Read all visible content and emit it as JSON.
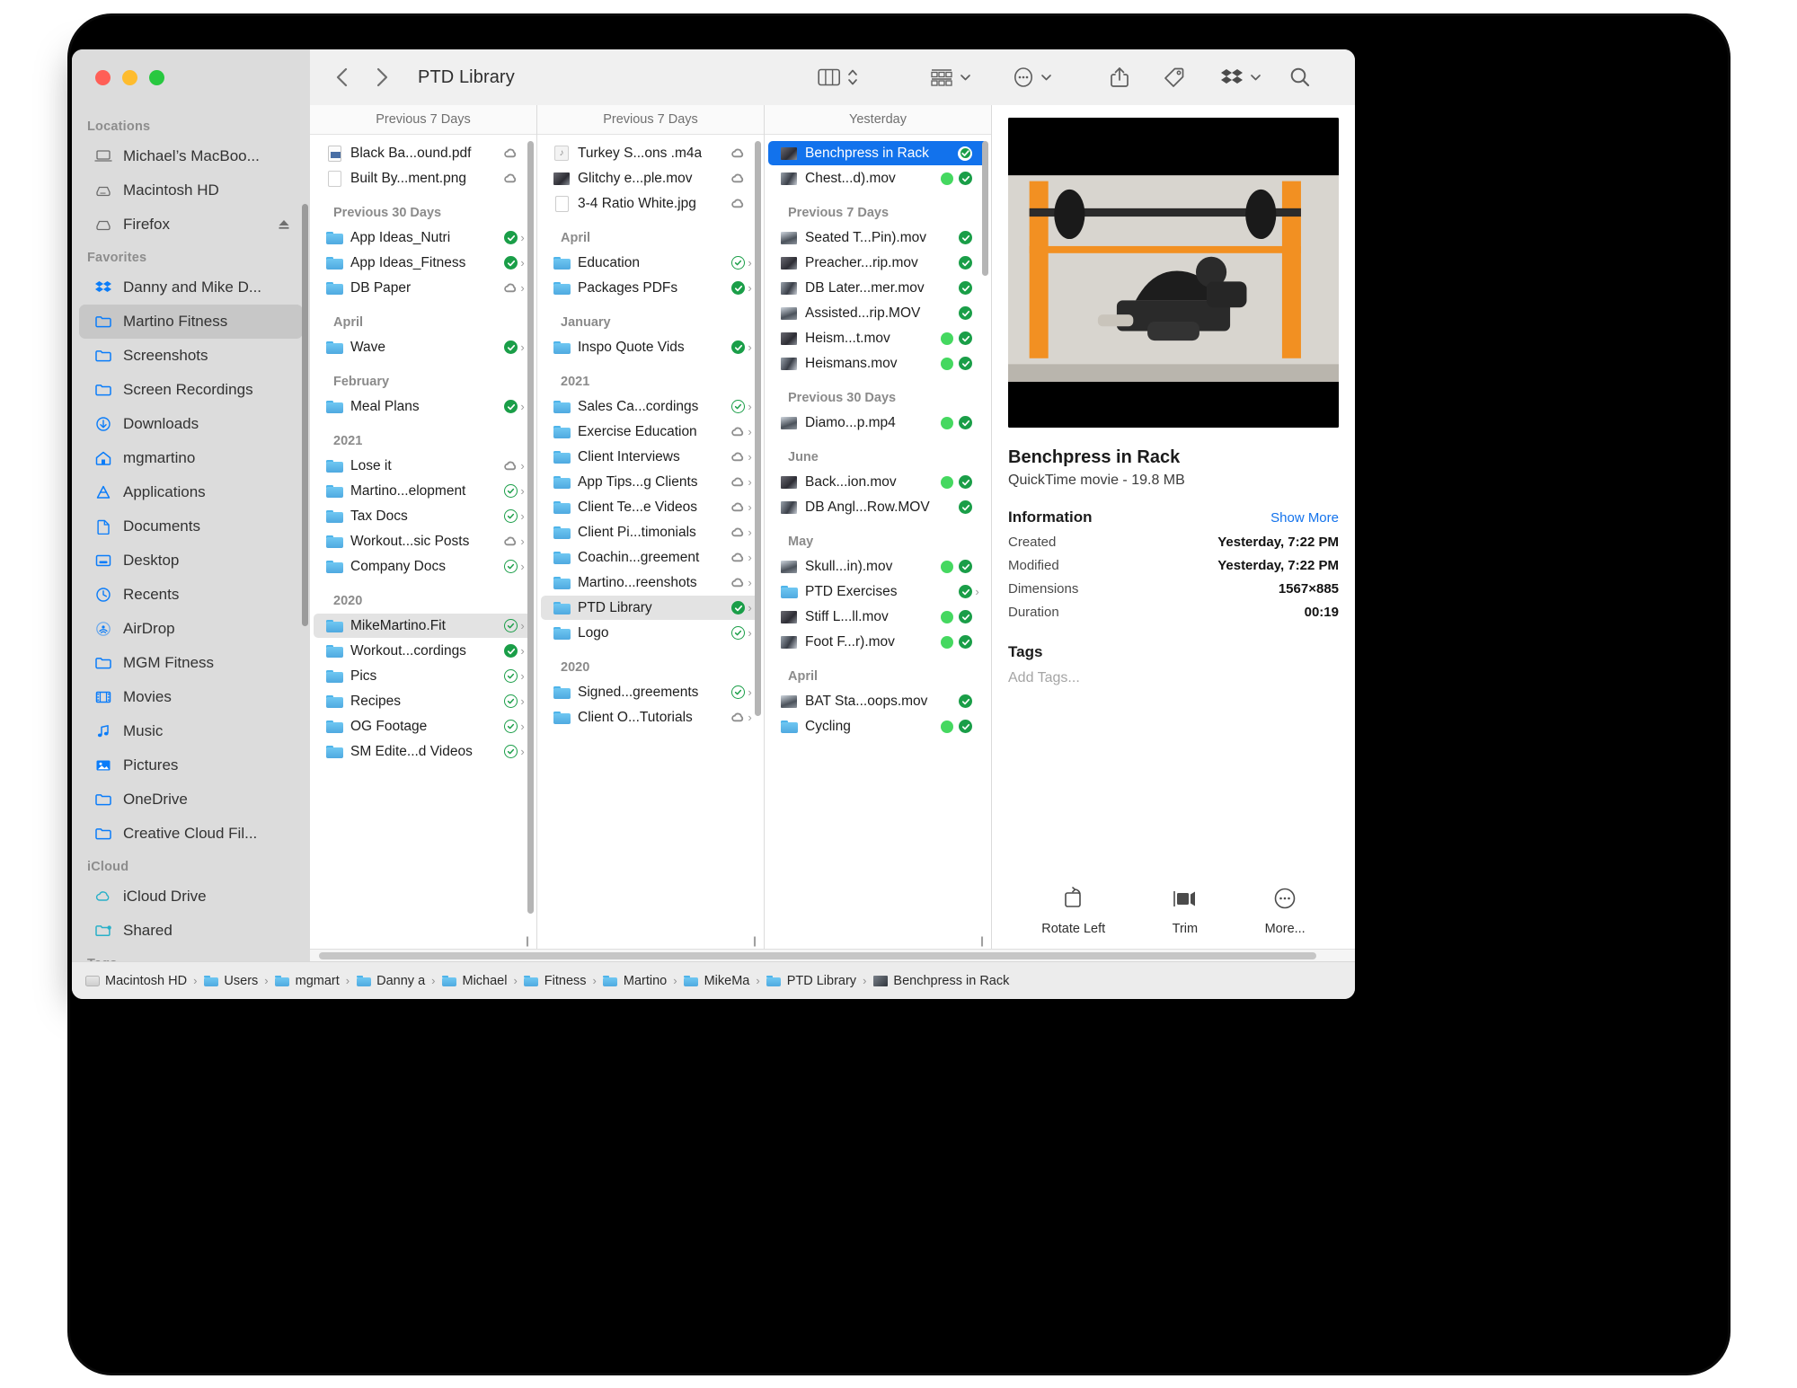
{
  "window": {
    "title": "PTD Library",
    "traffic": [
      "close",
      "minimize",
      "zoom"
    ]
  },
  "toolbar": {
    "back": "back-arrow",
    "forward": "forward-arrow",
    "view_mode": "column-view",
    "group_by": "group-by",
    "more": "more-options",
    "share": "share",
    "tag": "tag",
    "dropbox": "dropbox",
    "search": "search"
  },
  "sidebar": {
    "sections": [
      {
        "title": "Locations",
        "items": [
          {
            "label": "Michael’s MacBoo...",
            "icon": "laptop-icon",
            "tint": "gray",
            "eject": false
          },
          {
            "label": "Macintosh HD",
            "icon": "harddisk-icon",
            "tint": "gray",
            "eject": false
          },
          {
            "label": "Firefox",
            "icon": "disk-icon",
            "tint": "gray",
            "eject": true
          }
        ]
      },
      {
        "title": "Favorites",
        "items": [
          {
            "label": "Danny and Mike D...",
            "icon": "dropbox-icon",
            "tint": "blue",
            "eject": false
          },
          {
            "label": "Martino Fitness",
            "icon": "folder-icon",
            "tint": "blue",
            "eject": false,
            "active": true
          },
          {
            "label": "Screenshots",
            "icon": "folder-icon",
            "tint": "blue",
            "eject": false
          },
          {
            "label": "Screen Recordings",
            "icon": "folder-icon",
            "tint": "blue",
            "eject": false
          },
          {
            "label": "Downloads",
            "icon": "download-icon",
            "tint": "blue",
            "eject": false
          },
          {
            "label": "mgmartino",
            "icon": "home-icon",
            "tint": "blue",
            "eject": false
          },
          {
            "label": "Applications",
            "icon": "applications-icon",
            "tint": "blue",
            "eject": false
          },
          {
            "label": "Documents",
            "icon": "document-icon",
            "tint": "blue",
            "eject": false
          },
          {
            "label": "Desktop",
            "icon": "desktop-icon",
            "tint": "blue",
            "eject": false
          },
          {
            "label": "Recents",
            "icon": "clock-icon",
            "tint": "blue",
            "eject": false
          },
          {
            "label": "AirDrop",
            "icon": "airdrop-icon",
            "tint": "blue",
            "eject": false
          },
          {
            "label": "MGM Fitness",
            "icon": "folder-icon",
            "tint": "blue",
            "eject": false
          },
          {
            "label": "Movies",
            "icon": "film-icon",
            "tint": "blue",
            "eject": false
          },
          {
            "label": "Music",
            "icon": "music-icon",
            "tint": "blue",
            "eject": false
          },
          {
            "label": "Pictures",
            "icon": "pictures-icon",
            "tint": "blue",
            "eject": false
          },
          {
            "label": "OneDrive",
            "icon": "folder-icon",
            "tint": "blue",
            "eject": false
          },
          {
            "label": "Creative Cloud Fil...",
            "icon": "folder-icon",
            "tint": "blue",
            "eject": false
          }
        ]
      },
      {
        "title": "iCloud",
        "items": [
          {
            "label": "iCloud Drive",
            "icon": "cloud-icon",
            "tint": "teal",
            "eject": false
          },
          {
            "label": "Shared",
            "icon": "shared-folder-icon",
            "tint": "teal",
            "eject": false
          }
        ]
      },
      {
        "title": "Tags",
        "items": []
      }
    ]
  },
  "columns": [
    {
      "header": "Previous 7 Days",
      "groups": [
        {
          "label": "",
          "items": [
            {
              "name": "Black Ba...ound.pdf",
              "icon": "pdf-file-icon",
              "badges": [
                "cloud"
              ],
              "chevron": false
            },
            {
              "name": "Built By...ment.png",
              "icon": "image-file-icon",
              "badges": [
                "cloud"
              ],
              "chevron": false
            }
          ]
        },
        {
          "label": "Previous 30 Days",
          "items": [
            {
              "name": "App Ideas_Nutri",
              "icon": "folder-icon",
              "badges": [
                "check-filled"
              ],
              "chevron": true
            },
            {
              "name": "App Ideas_Fitness",
              "icon": "folder-icon",
              "badges": [
                "check-filled"
              ],
              "chevron": true
            },
            {
              "name": "DB Paper",
              "icon": "folder-icon",
              "badges": [
                "cloud"
              ],
              "chevron": true
            }
          ]
        },
        {
          "label": "April",
          "items": [
            {
              "name": "Wave",
              "icon": "folder-icon",
              "badges": [
                "check-filled"
              ],
              "chevron": true
            }
          ]
        },
        {
          "label": "February",
          "items": [
            {
              "name": "Meal Plans",
              "icon": "folder-icon",
              "badges": [
                "check-filled"
              ],
              "chevron": true
            }
          ]
        },
        {
          "label": "2021",
          "items": [
            {
              "name": "Lose it",
              "icon": "folder-icon",
              "badges": [
                "cloud"
              ],
              "chevron": true
            },
            {
              "name": "Martino...elopment",
              "icon": "folder-icon",
              "badges": [
                "check-outline"
              ],
              "chevron": true
            },
            {
              "name": "Tax Docs",
              "icon": "folder-icon",
              "badges": [
                "check-outline"
              ],
              "chevron": true
            },
            {
              "name": "Workout...sic Posts",
              "icon": "folder-icon",
              "badges": [
                "cloud"
              ],
              "chevron": true
            },
            {
              "name": "Company Docs",
              "icon": "folder-icon",
              "badges": [
                "check-outline"
              ],
              "chevron": true
            }
          ]
        },
        {
          "label": "2020",
          "items": [
            {
              "name": "MikeMartino.Fit",
              "icon": "folder-icon",
              "badges": [
                "check-outline"
              ],
              "chevron": true,
              "highlight": "gray"
            },
            {
              "name": "Workout...cordings",
              "icon": "folder-icon",
              "badges": [
                "check-filled"
              ],
              "chevron": true
            },
            {
              "name": "Pics",
              "icon": "folder-icon",
              "badges": [
                "check-outline"
              ],
              "chevron": true
            },
            {
              "name": "Recipes",
              "icon": "folder-icon",
              "badges": [
                "check-outline"
              ],
              "chevron": true
            },
            {
              "name": "OG Footage",
              "icon": "folder-icon",
              "badges": [
                "check-outline"
              ],
              "chevron": true
            },
            {
              "name": "SM Edite...d Videos",
              "icon": "folder-icon",
              "badges": [
                "check-outline"
              ],
              "chevron": true
            }
          ]
        }
      ]
    },
    {
      "header": "Previous 7 Days",
      "groups": [
        {
          "label": "",
          "items": [
            {
              "name": "Turkey S...ons .m4a",
              "icon": "audio-file-icon",
              "badges": [
                "cloud"
              ],
              "chevron": false
            },
            {
              "name": "Glitchy e...ple.mov",
              "icon": "video-file-icon",
              "badges": [
                "cloud"
              ],
              "chevron": false
            },
            {
              "name": "3-4 Ratio White.jpg",
              "icon": "image-file-icon",
              "badges": [
                "cloud"
              ],
              "chevron": false
            }
          ]
        },
        {
          "label": "April",
          "items": [
            {
              "name": "Education",
              "icon": "folder-icon",
              "badges": [
                "check-outline"
              ],
              "chevron": true
            },
            {
              "name": "Packages PDFs",
              "icon": "folder-icon",
              "badges": [
                "check-filled"
              ],
              "chevron": true
            }
          ]
        },
        {
          "label": "January",
          "items": [
            {
              "name": "Inspo Quote Vids",
              "icon": "folder-icon",
              "badges": [
                "check-filled"
              ],
              "chevron": true
            }
          ]
        },
        {
          "label": "2021",
          "items": [
            {
              "name": "Sales Ca...cordings",
              "icon": "folder-icon",
              "badges": [
                "check-outline"
              ],
              "chevron": true
            },
            {
              "name": "Exercise Education",
              "icon": "folder-icon",
              "badges": [
                "cloud"
              ],
              "chevron": true
            },
            {
              "name": "Client Interviews",
              "icon": "folder-icon",
              "badges": [
                "cloud"
              ],
              "chevron": true
            },
            {
              "name": "App Tips...g Clients",
              "icon": "folder-icon",
              "badges": [
                "cloud"
              ],
              "chevron": true
            },
            {
              "name": "Client Te...e Videos",
              "icon": "folder-icon",
              "badges": [
                "cloud"
              ],
              "chevron": true
            },
            {
              "name": "Client Pi...timonials",
              "icon": "folder-icon",
              "badges": [
                "cloud"
              ],
              "chevron": true
            },
            {
              "name": "Coachin...greement",
              "icon": "folder-icon",
              "badges": [
                "cloud"
              ],
              "chevron": true
            },
            {
              "name": "Martino...reenshots",
              "icon": "folder-icon",
              "badges": [
                "cloud"
              ],
              "chevron": true
            },
            {
              "name": "PTD Library",
              "icon": "folder-icon",
              "badges": [
                "check-filled"
              ],
              "chevron": true,
              "highlight": "gray"
            },
            {
              "name": "Logo",
              "icon": "folder-icon",
              "badges": [
                "check-outline"
              ],
              "chevron": true
            }
          ]
        },
        {
          "label": "2020",
          "items": [
            {
              "name": "Signed...greements",
              "icon": "folder-icon",
              "badges": [
                "check-outline"
              ],
              "chevron": true
            },
            {
              "name": "Client O...Tutorials",
              "icon": "folder-icon",
              "badges": [
                "cloud"
              ],
              "chevron": true
            }
          ]
        }
      ]
    },
    {
      "header": "Yesterday",
      "groups": [
        {
          "label": "",
          "items": [
            {
              "name": "Benchpress in Rack",
              "icon": "video-file-icon",
              "badges": [
                "selected-check"
              ],
              "chevron": false,
              "highlight": "blue"
            },
            {
              "name": "Chest...d).mov",
              "icon": "video-file-icon",
              "badges": [
                "tag-green",
                "check-filled"
              ],
              "chevron": false
            }
          ]
        },
        {
          "label": "Previous 7 Days",
          "items": [
            {
              "name": "Seated T...Pin).mov",
              "icon": "video-file-icon",
              "badges": [
                "check-filled"
              ],
              "chevron": false
            },
            {
              "name": "Preacher...rip.mov",
              "icon": "video-file-icon",
              "badges": [
                "check-filled"
              ],
              "chevron": false
            },
            {
              "name": "DB Later...mer.mov",
              "icon": "video-file-icon",
              "badges": [
                "check-filled"
              ],
              "chevron": false
            },
            {
              "name": "Assisted...rip.MOV",
              "icon": "video-file-icon",
              "badges": [
                "check-filled"
              ],
              "chevron": false
            },
            {
              "name": "Heism...t.mov",
              "icon": "video-file-icon",
              "badges": [
                "tag-green",
                "check-filled"
              ],
              "chevron": false
            },
            {
              "name": "Heismans.mov",
              "icon": "video-file-icon",
              "badges": [
                "tag-green",
                "check-filled"
              ],
              "chevron": false
            }
          ]
        },
        {
          "label": "Previous 30 Days",
          "items": [
            {
              "name": "Diamo...p.mp4",
              "icon": "video-file-icon",
              "badges": [
                "tag-green",
                "check-filled"
              ],
              "chevron": false
            }
          ]
        },
        {
          "label": "June",
          "items": [
            {
              "name": "Back...ion.mov",
              "icon": "video-file-icon",
              "badges": [
                "tag-green",
                "check-filled"
              ],
              "chevron": false
            },
            {
              "name": "DB Angl...Row.MOV",
              "icon": "video-file-icon",
              "badges": [
                "check-filled"
              ],
              "chevron": false
            }
          ]
        },
        {
          "label": "May",
          "items": [
            {
              "name": "Skull...in).mov",
              "icon": "video-file-icon",
              "badges": [
                "tag-green",
                "check-filled"
              ],
              "chevron": false
            },
            {
              "name": "PTD Exercises",
              "icon": "folder-icon",
              "badges": [
                "check-filled"
              ],
              "chevron": true
            },
            {
              "name": "Stiff L...ll.mov",
              "icon": "video-file-icon",
              "badges": [
                "tag-green",
                "check-filled"
              ],
              "chevron": false
            },
            {
              "name": "Foot F...r).mov",
              "icon": "video-file-icon",
              "badges": [
                "tag-green",
                "check-filled"
              ],
              "chevron": false
            }
          ]
        },
        {
          "label": "April",
          "items": [
            {
              "name": "BAT Sta...oops.mov",
              "icon": "video-file-icon",
              "badges": [
                "check-filled"
              ],
              "chevron": false
            },
            {
              "name": "Cycling",
              "icon": "folder-icon",
              "badges": [
                "tag-green",
                "check-filled"
              ],
              "chevron": false
            }
          ]
        }
      ]
    }
  ],
  "preview": {
    "thumbnail_alt": "benchpress-in-rack-video-thumbnail",
    "title": "Benchpress in Rack",
    "subtitle": "QuickTime movie - 19.8 MB",
    "info_heading": "Information",
    "show_more": "Show More",
    "rows": [
      {
        "key": "Created",
        "value": "Yesterday, 7:22 PM"
      },
      {
        "key": "Modified",
        "value": "Yesterday, 7:22 PM"
      },
      {
        "key": "Dimensions",
        "value": "1567×885"
      },
      {
        "key": "Duration",
        "value": "00:19"
      }
    ],
    "tags_heading": "Tags",
    "tags_placeholder": "Add Tags...",
    "actions": [
      {
        "label": "Rotate Left",
        "icon": "rotate-left-icon"
      },
      {
        "label": "Trim",
        "icon": "trim-icon"
      },
      {
        "label": "More...",
        "icon": "ellipsis-circle-icon"
      }
    ]
  },
  "pathbar": [
    {
      "label": "Macintosh HD",
      "icon": "harddisk-icon"
    },
    {
      "label": "Users",
      "icon": "folder-icon"
    },
    {
      "label": "mgmart",
      "icon": "folder-icon"
    },
    {
      "label": "Danny a",
      "icon": "folder-icon"
    },
    {
      "label": "Michael",
      "icon": "folder-icon"
    },
    {
      "label": "Fitness",
      "icon": "folder-icon"
    },
    {
      "label": "Martino",
      "icon": "folder-icon"
    },
    {
      "label": "MikeMa",
      "icon": "folder-icon"
    },
    {
      "label": "PTD Library",
      "icon": "folder-icon"
    },
    {
      "label": "Benchpress in Rack",
      "icon": "video-file-icon"
    }
  ],
  "colors": {
    "accent_blue": "#1272ec",
    "folder_blue": "#4fa9e0",
    "check_green": "#1a9e48",
    "tag_green": "#45d860",
    "sidebar_bg": "#dcdcdc"
  }
}
